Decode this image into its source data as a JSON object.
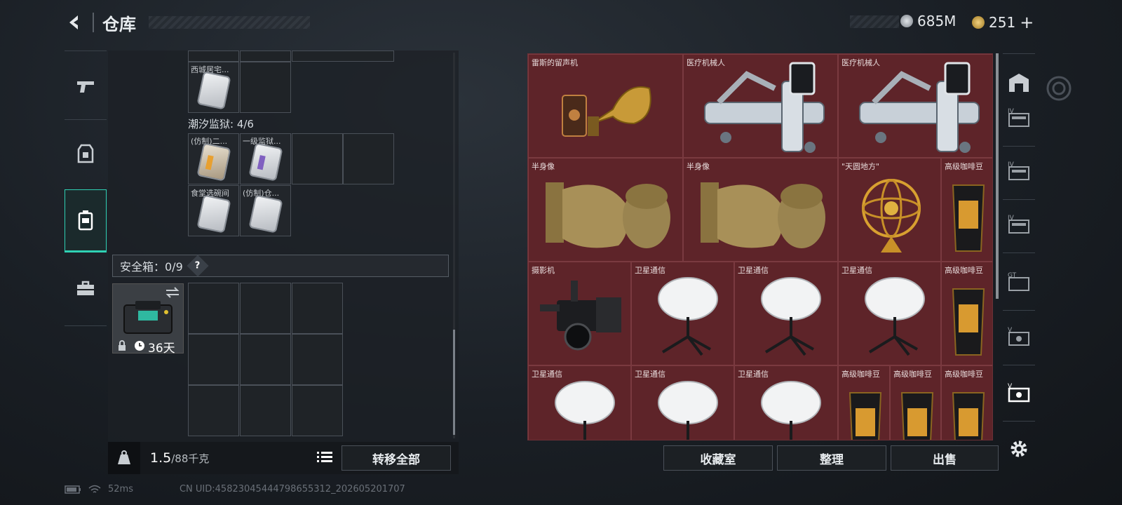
{
  "header": {
    "title": "仓库",
    "currency_silver": "685M",
    "currency_gold": "251",
    "add_symbol": "+"
  },
  "left": {
    "top_item_label": "西城居宅...",
    "prison_section": "潮汐监狱: 4/6",
    "prison_items": [
      "(仿制)二...",
      "一级监狱...",
      "食堂选碗间",
      "(仿制)仓..."
    ],
    "safebox_label": "安全箱：0/9",
    "safebox_help": "?",
    "safebox_days": "36天",
    "weight_current": "1.5",
    "weight_capacity": "/88千克",
    "transfer_all": "转移全部"
  },
  "right": {
    "items": {
      "r1c1": "雷斯的留声机",
      "r1c2": "医疗机械人",
      "r1c3": "医疗机械人",
      "r2c1": "半身像",
      "r2c2": "半身像",
      "r2c3": "\"天圆地方\"",
      "r2c4": "高级咖啡豆",
      "r3c1": "摄影机",
      "r3c2": "卫星通信",
      "r3c3": "卫星通信",
      "r3c4": "卫星通信",
      "r3c5": "高级咖啡豆",
      "r4c1": "卫星通信",
      "r4c2": "卫星通信",
      "r4c3": "卫星通信",
      "r4c4": "高级咖啡豆",
      "r4c5": "高级咖啡豆",
      "r4c6": "高级咖啡豆"
    },
    "buttons": {
      "collection": "收藏室",
      "sort": "整理",
      "sell": "出售"
    }
  },
  "status": {
    "ping": "52ms",
    "uid": "CN UID:45823045444798655312_202605201707"
  },
  "colors": {
    "accent": "#2fd1b4",
    "panel_red": "#5a2126"
  }
}
